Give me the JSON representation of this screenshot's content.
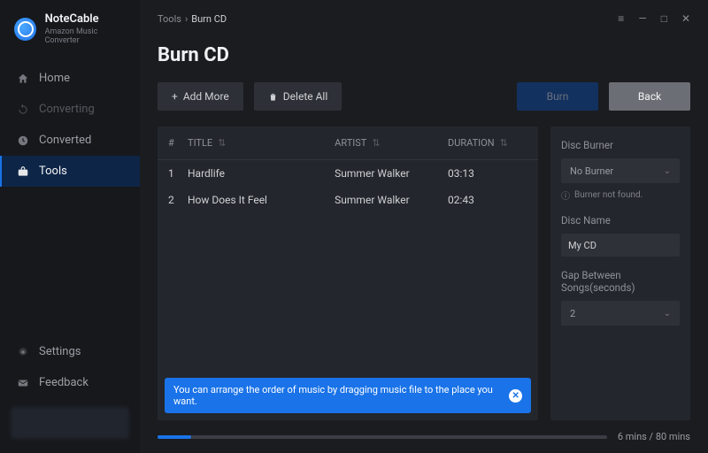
{
  "brand": {
    "name": "NoteCable",
    "subtitle": "Amazon Music Converter"
  },
  "nav": {
    "home": "Home",
    "converting": "Converting",
    "converted": "Converted",
    "tools": "Tools",
    "settings": "Settings",
    "feedback": "Feedback"
  },
  "breadcrumb": {
    "parent": "Tools",
    "current": "Burn CD"
  },
  "page_title": "Burn CD",
  "buttons": {
    "add_more": "Add More",
    "delete_all": "Delete All",
    "burn": "Burn",
    "back": "Back"
  },
  "table": {
    "headers": {
      "index": "#",
      "title": "TITLE",
      "artist": "ARTIST",
      "duration": "DURATION"
    },
    "rows": [
      {
        "n": "1",
        "title": "Hardlife",
        "artist": "Summer Walker",
        "duration": "03:13"
      },
      {
        "n": "2",
        "title": "How Does It Feel",
        "artist": "Summer Walker",
        "duration": "02:43"
      }
    ]
  },
  "panel": {
    "disc_burner_label": "Disc Burner",
    "burner_value": "No Burner",
    "burner_warning": "Burner not found.",
    "disc_name_label": "Disc Name",
    "disc_name_value": "My CD",
    "gap_label": "Gap Between Songs(seconds)",
    "gap_value": "2"
  },
  "info_tip": "You can arrange the order of music by dragging music file to the place you want.",
  "progress": {
    "text": "6 mins / 80 mins"
  }
}
